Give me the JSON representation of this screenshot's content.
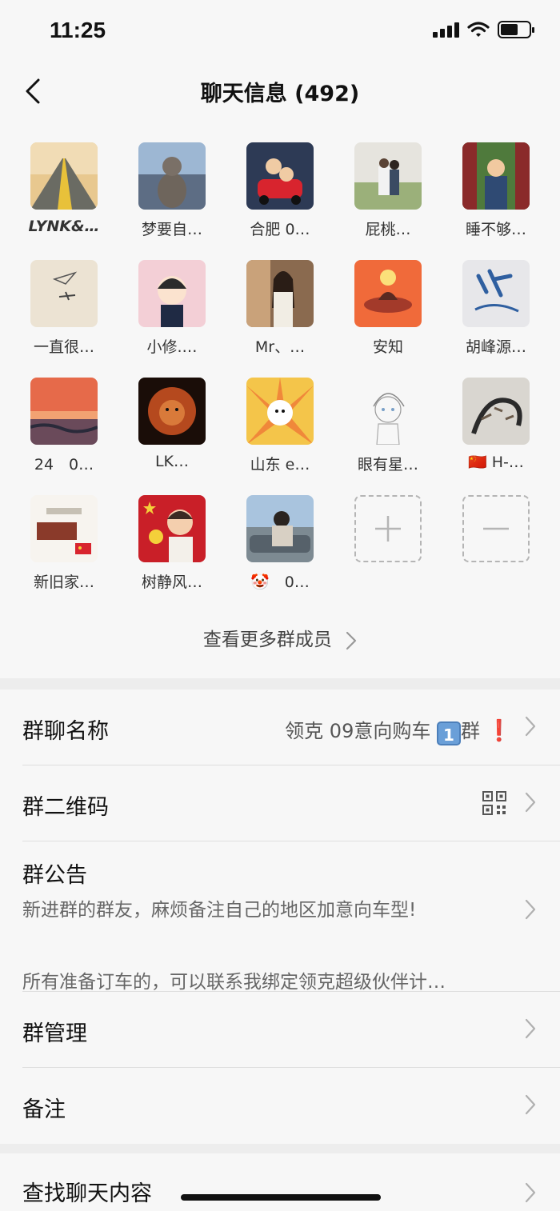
{
  "status": {
    "time": "11:25"
  },
  "nav": {
    "title": "聊天信息 (492)"
  },
  "members": [
    {
      "name": "LYNK&…",
      "avatar": "road-photo"
    },
    {
      "name": "梦要自…",
      "avatar": "dog-photo"
    },
    {
      "name": "合肥 0…",
      "avatar": "kids-car-photo"
    },
    {
      "name": "屁桃…",
      "avatar": "couple-photo"
    },
    {
      "name": "睡不够…",
      "avatar": "child-pavilion-photo"
    },
    {
      "name": "一直很…",
      "avatar": "paper-plane-drawing"
    },
    {
      "name": "小修.…",
      "avatar": "anime-boy-drawing"
    },
    {
      "name": "Mr、…",
      "avatar": "girl-photo"
    },
    {
      "name": "安知",
      "avatar": "island-illustration"
    },
    {
      "name": "胡峰源…",
      "avatar": "calligraphy-hu"
    },
    {
      "name": "24　0…",
      "avatar": "sunset-photo"
    },
    {
      "name": "LK…",
      "avatar": "lion-photo"
    },
    {
      "name": "山东 e…",
      "avatar": "cartoon-character"
    },
    {
      "name": "眼有星…",
      "avatar": "anime-sketch"
    },
    {
      "name": "🇨🇳 H-…",
      "avatar": "tiger-painting"
    },
    {
      "name": "新旧家…",
      "avatar": "family-graphic"
    },
    {
      "name": "树静风…",
      "avatar": "boy-flag-photo"
    },
    {
      "name": "🤡　0…",
      "avatar": "man-car-photo"
    }
  ],
  "actions": {
    "add_icon": "plus-icon",
    "remove_icon": "minus-icon"
  },
  "more_members": "查看更多群成员",
  "settings": {
    "group_name_label": "群聊名称",
    "group_name_value_prefix": "领克 09意向购车",
    "group_name_keycap": "1",
    "group_name_suffix": "群",
    "group_name_emoji": "❗",
    "qr_label": "群二维码",
    "notice_label": "群公告",
    "notice_line1": "新进群的群友，麻烦备注自己的地区加意向车型!",
    "notice_line2": "所有准备订车的，可以联系我绑定领克超级伙伴计…",
    "manage_label": "群管理",
    "remark_label": "备注"
  },
  "search": {
    "label": "查找聊天内容"
  },
  "colors": {
    "background": "#ededed",
    "card": "#f7f7f7",
    "divider": "#dedede",
    "chevron": "#b0b0b0"
  }
}
